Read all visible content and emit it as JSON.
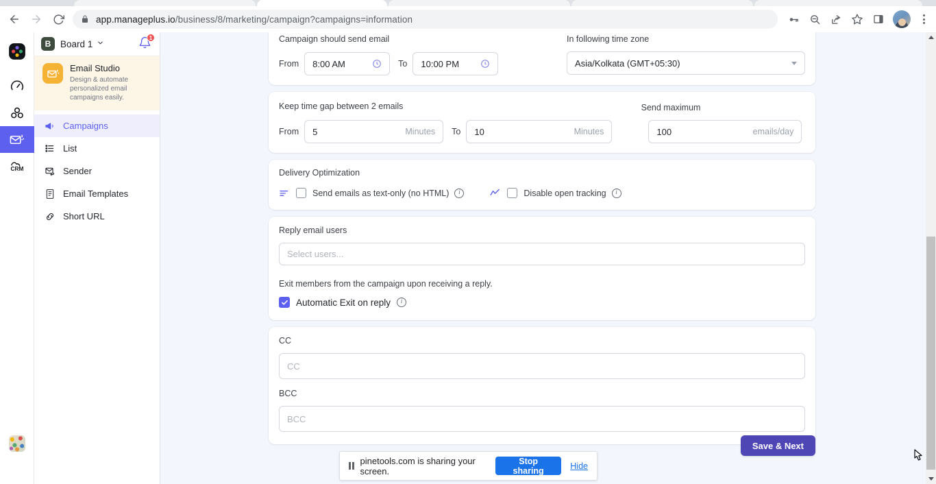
{
  "browser": {
    "url_bold": "app.manageplus.io",
    "url_rest": "/business/8/marketing/campaign?campaigns=information",
    "back_icon": "back-arrow-icon",
    "forward_icon": "forward-arrow-icon",
    "reload_icon": "reload-icon",
    "lock_icon": "lock-icon",
    "key_icon": "key-icon",
    "zoom_icon": "zoom-out-icon",
    "share_icon": "share-icon",
    "star_icon": "star-icon",
    "sidepanel_icon": "side-panel-icon",
    "profile_icon": "profile-avatar",
    "menu_icon": "three-dot-menu-icon"
  },
  "rail": {
    "items": [
      {
        "name": "app-logo",
        "label": ""
      },
      {
        "name": "dashboard",
        "label": ""
      },
      {
        "name": "teams",
        "label": ""
      },
      {
        "name": "email-marketing",
        "label": ""
      },
      {
        "name": "crm",
        "label": "CRM"
      }
    ]
  },
  "sidebar": {
    "board_initial": "B",
    "board_name": "Board 1",
    "notification_count": "1",
    "studio": {
      "title": "Email Studio",
      "subtitle": "Design & automate personalized email campaigns easily."
    },
    "nav": [
      {
        "label": "Campaigns",
        "icon": "megaphone-icon",
        "active": true
      },
      {
        "label": "List",
        "icon": "list-icon",
        "active": false
      },
      {
        "label": "Sender",
        "icon": "sender-envelope-icon",
        "active": false
      },
      {
        "label": "Email Templates",
        "icon": "template-icon",
        "active": false
      },
      {
        "label": "Short URL",
        "icon": "link-icon",
        "active": false
      }
    ]
  },
  "main": {
    "send_window": {
      "label": "Campaign should send email",
      "from_label": "From",
      "from_value": "8:00 AM",
      "to_label": "To",
      "to_value": "10:00 PM",
      "timezone_label": "In following time zone",
      "timezone_value": "Asia/Kolkata (GMT+05:30)"
    },
    "time_gap": {
      "label": "Keep time gap between 2 emails",
      "from_label": "From",
      "from_value": "5",
      "from_unit": "Minutes",
      "to_label": "To",
      "to_value": "10",
      "to_unit": "Minutes",
      "max_label": "Send maximum",
      "max_value": "100",
      "max_unit": "emails/day"
    },
    "delivery": {
      "label": "Delivery Optimization",
      "text_only_label": "Send emails as text-only (no HTML)",
      "text_only_checked": false,
      "disable_tracking_label": "Disable open tracking",
      "disable_tracking_checked": false,
      "info_label": "i"
    },
    "reply": {
      "label": "Reply email users",
      "placeholder": "Select users...",
      "exit_note": "Exit members from the campaign upon receiving a reply.",
      "auto_exit_label": "Automatic Exit on reply",
      "auto_exit_checked": true,
      "info_label": "i"
    },
    "cc": {
      "cc_label": "CC",
      "cc_placeholder": "CC",
      "bcc_label": "BCC",
      "bcc_placeholder": "BCC"
    },
    "save_button": "Save & Next"
  },
  "share_bar": {
    "message": "pinetools.com is sharing your screen.",
    "stop_label": "Stop sharing",
    "hide_label": "Hide"
  },
  "colors": {
    "accent": "#5d5fef",
    "save_button": "#4f46b5",
    "stop_sharing": "#1a73e8",
    "studio_bg": "#fdf6e7",
    "studio_icon": "#f5b335",
    "page_bg": "#f3f7fd",
    "badge_red": "#f05151"
  }
}
